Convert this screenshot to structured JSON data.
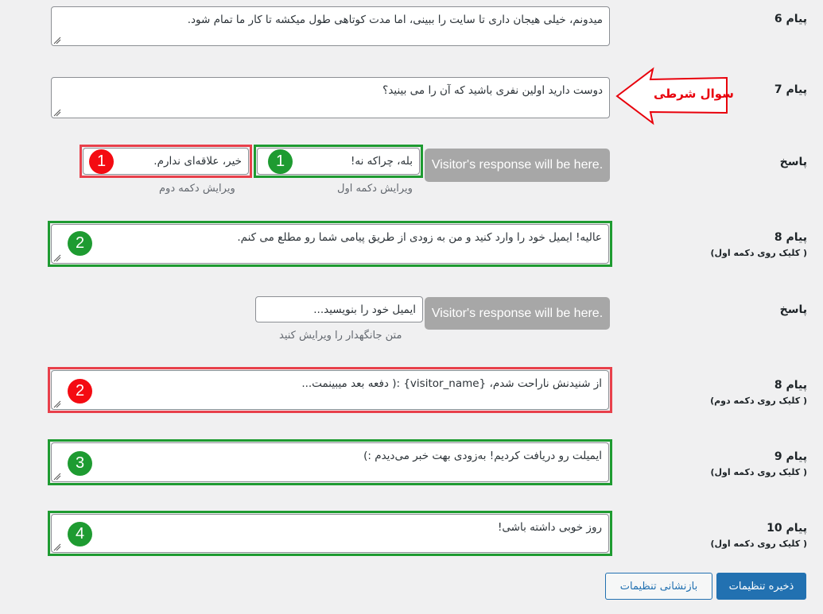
{
  "rows": {
    "msg6": {
      "label": "پیام 6",
      "text": "میدونم، خیلی هیجان داری تا سایت را ببینی، اما مدت کوتاهی طول میکشه تا کار ما تمام شود."
    },
    "msg7": {
      "label": "پیام 7",
      "text": "دوست دارید اولین نفری باشید که آن را می بینید؟",
      "annotation": "سوال شرطی"
    },
    "reply1": {
      "label": "پاسخ",
      "visitor_button": "Visitor's response will be here.",
      "button1_value": "بله، چراکه نه!",
      "button1_hint": "ویرایش دکمه اول",
      "button1_badge": "1",
      "button2_value": "خیر، علاقه‌ای ندارم.",
      "button2_hint": "ویرایش دکمه دوم",
      "button2_badge": "1"
    },
    "msg8a": {
      "label": "پیام 8",
      "sublabel": "( کلیک روی دکمه اول)",
      "text": "عالیه! ایمیل خود را وارد کنید و من به زودی از طریق پیامی شما رو مطلع می کنم.",
      "badge": "2"
    },
    "reply2": {
      "label": "پاسخ",
      "visitor_button": "Visitor's response will be here.",
      "placeholder_value": "ایمیل خود را بنویسید...",
      "hint": "متن جانگهدار را ویرایش کنید"
    },
    "msg8b": {
      "label": "پیام 8",
      "sublabel": "( کلیک روی دکمه دوم)",
      "text": "از شنیدنش ناراحت شدم، {visitor_name} :( دفعه بعد میبینمت...",
      "badge": "2"
    },
    "msg9": {
      "label": "پیام 9",
      "sublabel": "( کلیک روی دکمه اول)",
      "text": "ایمیلت رو دریافت کردیم! به‌زودی بهت خبر می‌دیدم :)",
      "badge": "3"
    },
    "msg10": {
      "label": "پیام 10",
      "sublabel": "( کلیک روی دکمه اول)",
      "text": "روز خوبی داشته باشی!",
      "badge": "4"
    }
  },
  "footer": {
    "save_label": "ذخیره تنظیمات",
    "reset_label": "بازنشانی تنظیمات"
  },
  "colors": {
    "highlight_green": "#1e9b31",
    "highlight_red": "#e8404b",
    "primary": "#2271b1",
    "annotation_red": "#e8000b"
  }
}
